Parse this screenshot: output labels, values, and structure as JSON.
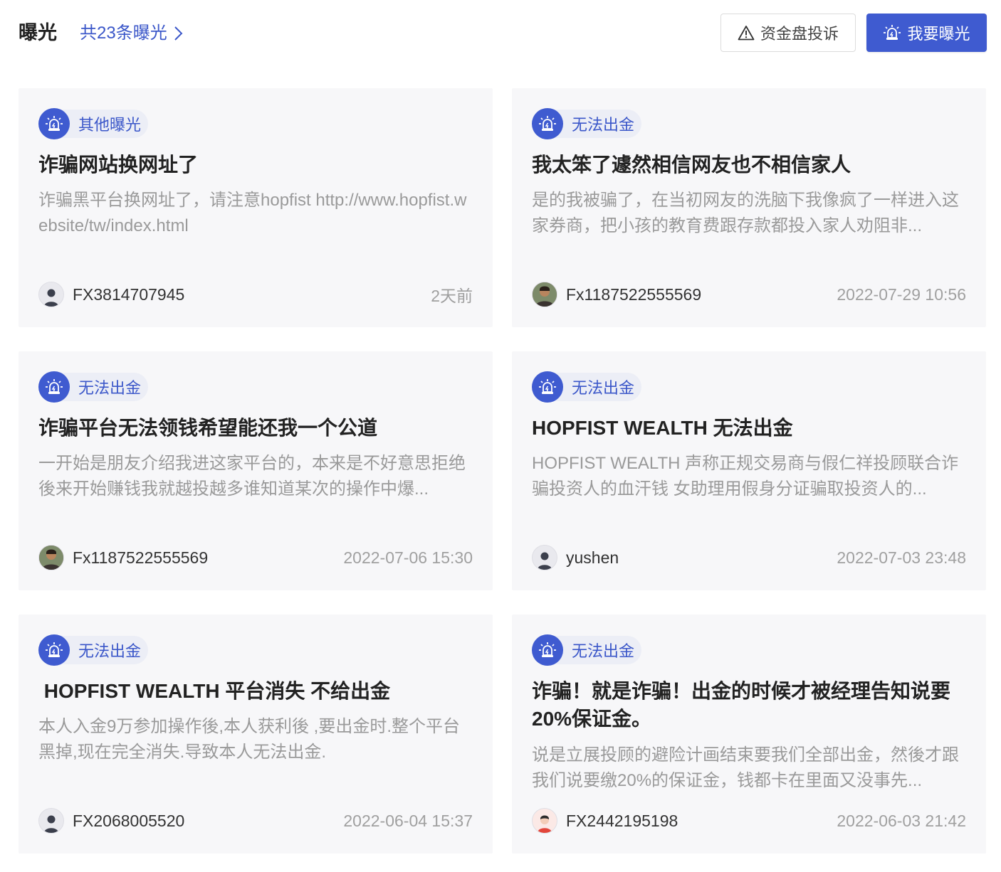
{
  "header": {
    "title": "曝光",
    "count_label": "共23条曝光",
    "complaint_button": "资金盘投诉",
    "expose_button": "我要曝光"
  },
  "colors": {
    "accent": "#3f5bd0",
    "tag_bg": "#eceef6",
    "card_bg": "#f7f7f9",
    "desc_text": "#9a9a9a"
  },
  "cards": [
    {
      "tag": "其他曝光",
      "title": "诈骗网站换网址了",
      "desc": "诈骗黑平台换网址了，请注意hopfist http://www.hopfist.website/tw/index.html",
      "author": "FX3814707945",
      "avatar": "default-avatar",
      "time": "2天前"
    },
    {
      "tag": "无法出金",
      "title": "我太笨了遽然相信网友也不相信家人",
      "desc": "是的我被骗了，在当初网友的洗脑下我像疯了一样进入这家券商，把小孩的教育费跟存款都投入家人劝阻非...",
      "author": "Fx1187522555569",
      "avatar": "photo-avatar",
      "time": "2022-07-29 10:56"
    },
    {
      "tag": "无法出金",
      "title": "诈骗平台无法领钱希望能还我一个公道",
      "desc": "一开始是朋友介绍我进这家平台的，本来是不好意思拒绝後来开始赚钱我就越投越多谁知道某次的操作中爆...",
      "author": "Fx1187522555569",
      "avatar": "photo-avatar",
      "time": "2022-07-06 15:30"
    },
    {
      "tag": "无法出金",
      "title": "HOPFIST WEALTH 无法出金",
      "desc": "HOPFIST WEALTH 声称正规交易商与假仁祥投顾联合诈骗投资人的血汗钱 女助理用假身分证骗取投资人的...",
      "author": "yushen",
      "avatar": "default-avatar",
      "time": "2022-07-03 23:48"
    },
    {
      "tag": "无法出金",
      "title": " HOPFIST WEALTH 平台消失 不给出金",
      "desc": "本人入金9万参加操作後,本人获利後 ,要出金时.整个平台黑掉,现在完全消失.导致本人无法出金.",
      "author": "FX2068005520",
      "avatar": "default-avatar",
      "time": "2022-06-04 15:37"
    },
    {
      "tag": "无法出金",
      "title": "诈骗！就是诈骗！出金的时候才被经理告知说要20%保证金。",
      "desc": "说是立展投顾的避险计画结束要我们全部出金，然後才跟我们说要缴20%的保证金，钱都卡在里面又没事先...",
      "author": "FX2442195198",
      "avatar": "cartoon-avatar",
      "time": "2022-06-03 21:42"
    }
  ]
}
